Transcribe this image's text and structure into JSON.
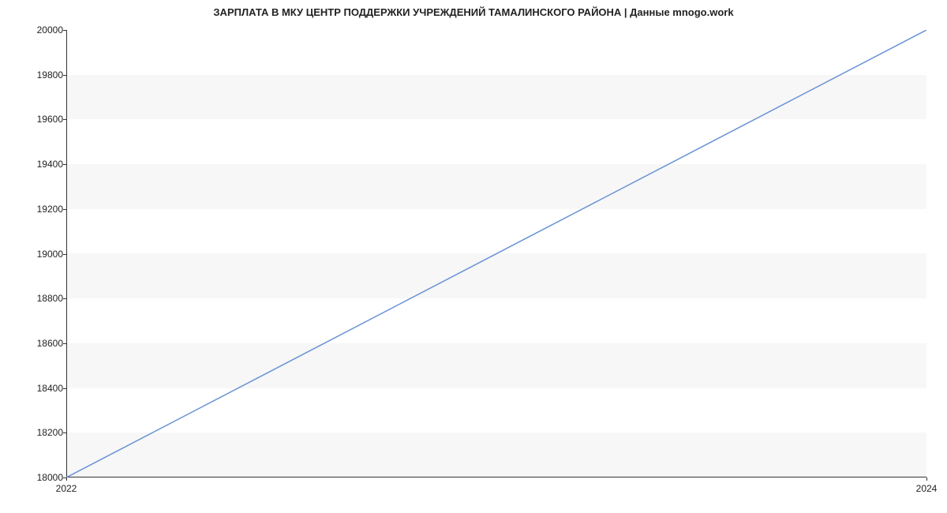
{
  "chart_data": {
    "type": "line",
    "title": "ЗАРПЛАТА В МКУ ЦЕНТР ПОДДЕРЖКИ УЧРЕЖДЕНИЙ ТАМАЛИНСКОГО РАЙОНА | Данные mnogo.work",
    "x": [
      2022,
      2024
    ],
    "values": [
      18000,
      20000
    ],
    "xlabel": "",
    "ylabel": "",
    "x_ticks": [
      2022,
      2024
    ],
    "y_ticks": [
      18000,
      18200,
      18400,
      18600,
      18800,
      19000,
      19200,
      19400,
      19600,
      19800,
      20000
    ],
    "xlim": [
      2022,
      2024
    ],
    "ylim": [
      18000,
      20000
    ],
    "line_color": "#6a93d4"
  }
}
